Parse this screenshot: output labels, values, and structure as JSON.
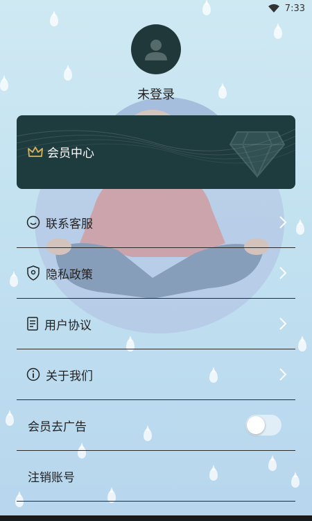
{
  "status_bar": {
    "time": "7:33"
  },
  "profile": {
    "login_label": "未登录"
  },
  "vip_card": {
    "title": "会员中心"
  },
  "menu": {
    "contact": "联系客服",
    "privacy": "隐私政策",
    "agreement": "用户协议",
    "about": "关于我们",
    "ad_free": "会员去广告",
    "cancel_account": "注销账号"
  },
  "toggles": {
    "ad_free_enabled": false
  },
  "colors": {
    "card_bg": "#1e3b3e",
    "crown": "#d9b35b",
    "avatar_bg": "#20383a"
  },
  "icons": {
    "contact": "smile-icon",
    "privacy": "shield-icon",
    "agreement": "document-icon",
    "about": "info-icon",
    "vip": "crown-icon",
    "chevron": "chevron-right-icon"
  }
}
